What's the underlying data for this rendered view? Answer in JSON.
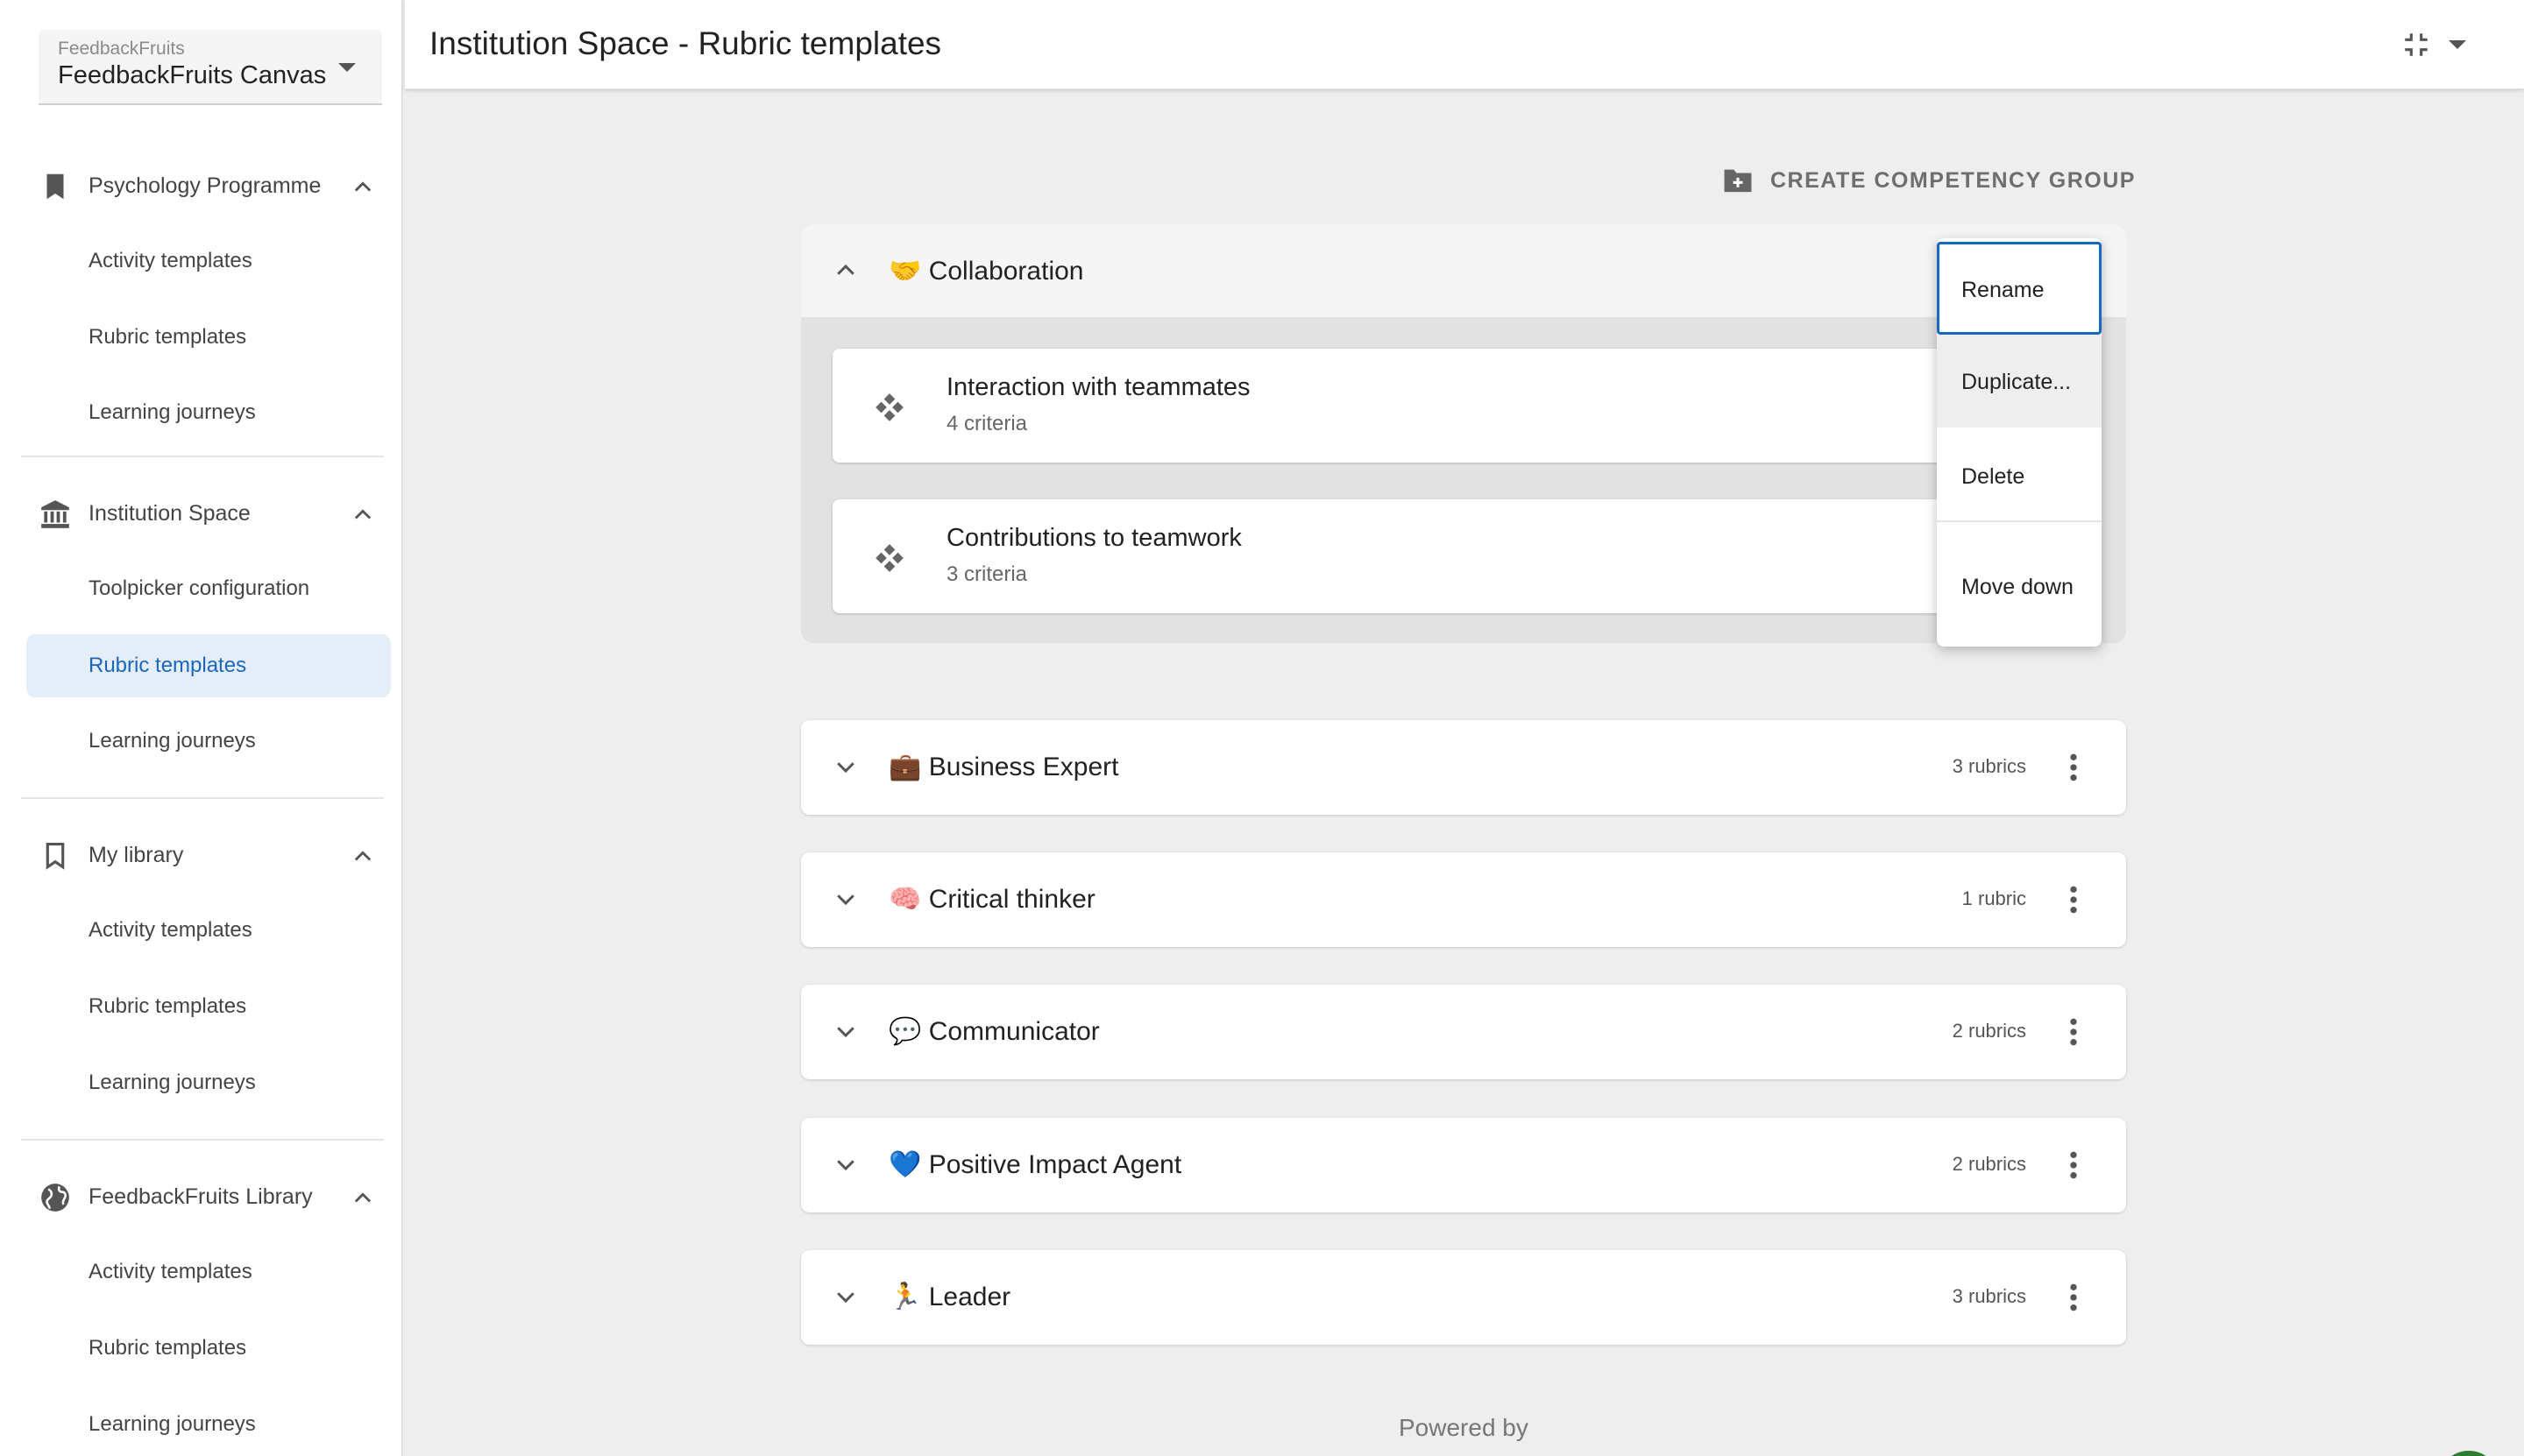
{
  "workspace": {
    "org": "FeedbackFruits",
    "name": "FeedbackFruits Canvas"
  },
  "sidebar": {
    "sections": [
      {
        "label": "Psychology Programme",
        "icon": "bookmark-filled-icon",
        "items": [
          "Activity templates",
          "Rubric templates",
          "Learning journeys"
        ]
      },
      {
        "label": "Institution Space",
        "icon": "institution-icon",
        "items": [
          "Toolpicker configuration",
          "Rubric templates",
          "Learning journeys"
        ],
        "active_item": "Rubric templates"
      },
      {
        "label": "My library",
        "icon": "bookmark-outline-icon",
        "items": [
          "Activity templates",
          "Rubric templates",
          "Learning journeys"
        ]
      },
      {
        "label": "FeedbackFruits Library",
        "icon": "globe-icon",
        "items": [
          "Activity templates",
          "Rubric templates",
          "Learning journeys"
        ]
      }
    ]
  },
  "header": {
    "title": "Institution Space - Rubric templates"
  },
  "toolbar": {
    "create_group_label": "CREATE COMPETENCY GROUP"
  },
  "expanded_group": {
    "emoji": "🤝",
    "name": "Collaboration",
    "rubrics": [
      {
        "name": "Interaction with teammates",
        "criteria": "4 criteria"
      },
      {
        "name": "Contributions to teamwork",
        "criteria": "3 criteria"
      }
    ]
  },
  "groups": [
    {
      "emoji": "💼",
      "name": "Business Expert",
      "count": "3 rubrics"
    },
    {
      "emoji": "🧠",
      "name": "Critical thinker",
      "count": "1 rubric"
    },
    {
      "emoji": "💬",
      "name": "Communicator",
      "count": "2 rubrics"
    },
    {
      "emoji": "💙",
      "name": "Positive Impact Agent",
      "count": "2 rubrics"
    },
    {
      "emoji": "🏃",
      "name": "Leader",
      "count": "3 rubrics"
    }
  ],
  "context_menu": {
    "rename": "Rename",
    "duplicate": "Duplicate...",
    "delete": "Delete",
    "move_down": "Move down"
  },
  "footer": {
    "powered_by": "Powered by"
  },
  "colors": {
    "accent": "#1a67c0",
    "active_bg": "#e5edf8",
    "page_bg": "#eeeeee",
    "chat_green": "#2e7d32"
  }
}
